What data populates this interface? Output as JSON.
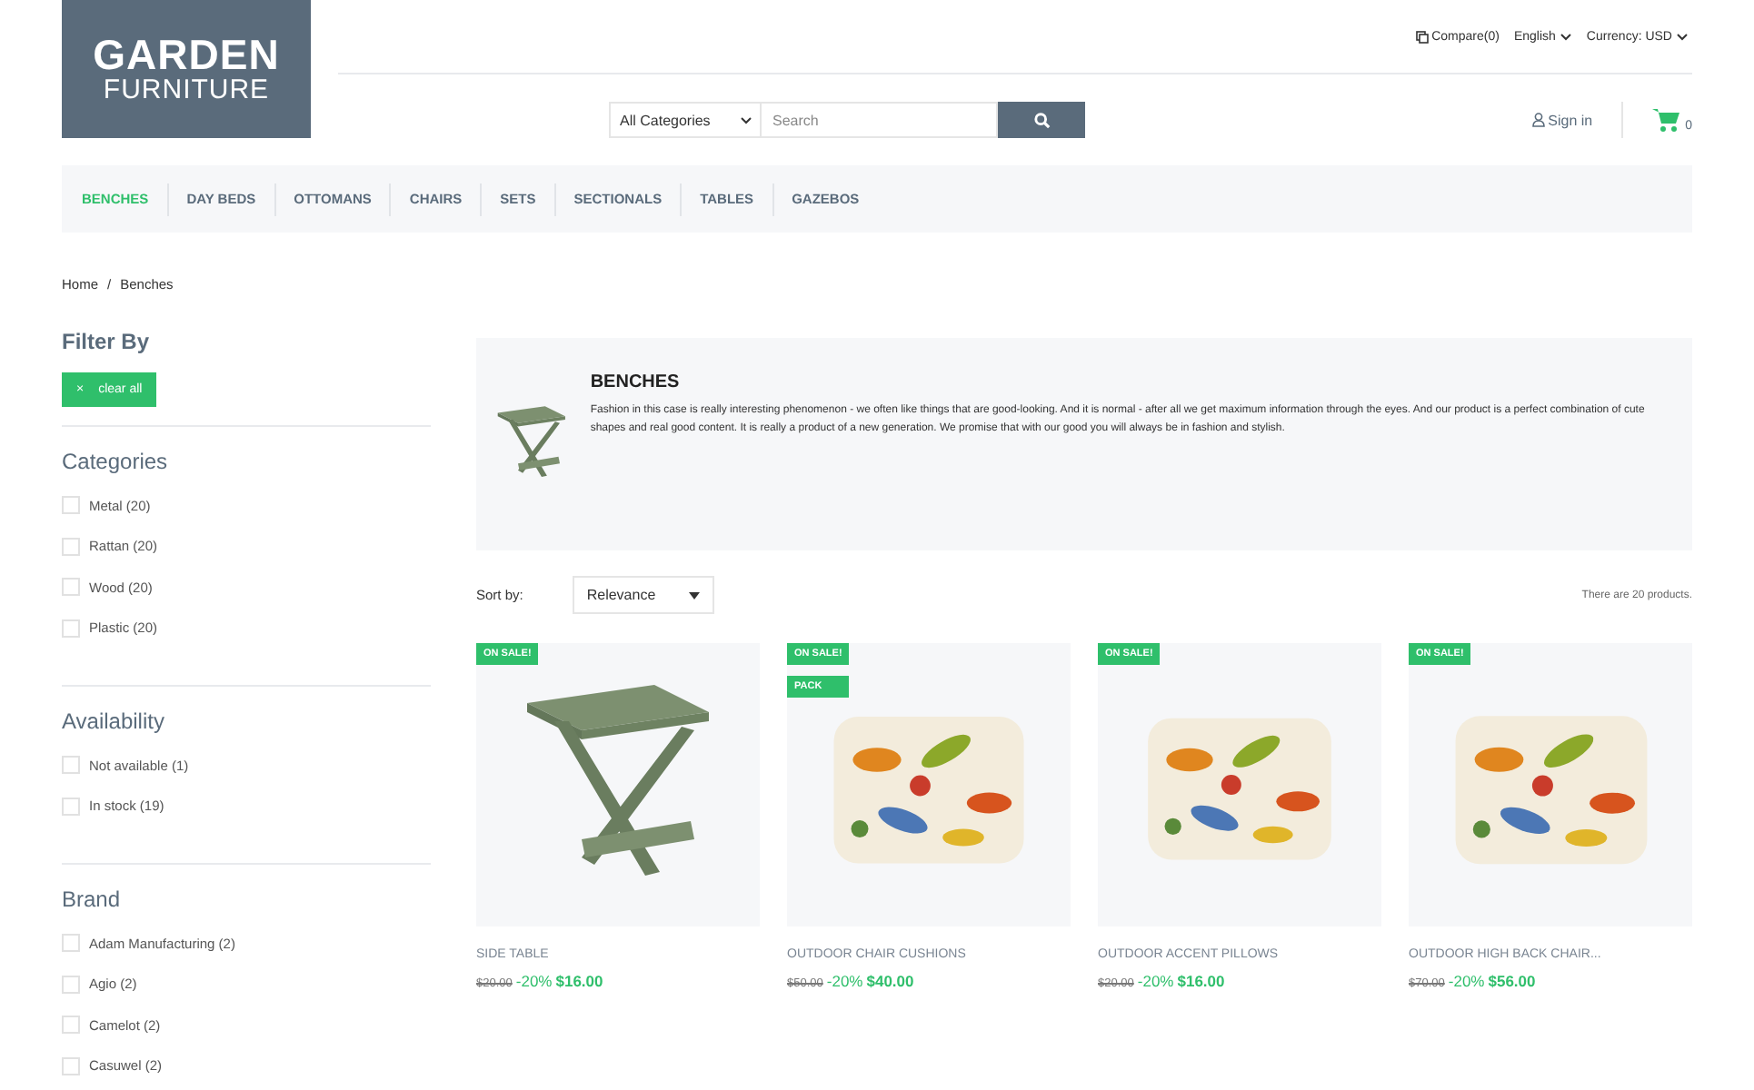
{
  "logo": {
    "line1": "GARDEN",
    "line2": "FURNITURE"
  },
  "top_links": {
    "compare": "Compare(0)",
    "language": "English",
    "currency": "Currency: USD"
  },
  "search": {
    "category": "All Categories",
    "placeholder": "Search"
  },
  "account": {
    "sign_in": "Sign in",
    "cart_count": "0"
  },
  "nav": [
    {
      "label": "BENCHES",
      "selected": true
    },
    {
      "label": "DAY BEDS",
      "selected": false
    },
    {
      "label": "OTTOMANS",
      "selected": false
    },
    {
      "label": "CHAIRS",
      "selected": false
    },
    {
      "label": "SETS",
      "selected": false
    },
    {
      "label": "SECTIONALS",
      "selected": false
    },
    {
      "label": "TABLES",
      "selected": false
    },
    {
      "label": "GAZEBOS",
      "selected": false
    }
  ],
  "breadcrumb": [
    "Home",
    "Benches"
  ],
  "breadcrumb_separator": "/",
  "filter": {
    "title": "Filter By",
    "clear_icon": "×",
    "clear": "clear all",
    "groups": [
      {
        "title": "Categories",
        "options": [
          {
            "label": "Metal (20)",
            "checked": false
          },
          {
            "label": "Rattan (20)",
            "checked": false
          },
          {
            "label": "Wood (20)",
            "checked": false
          },
          {
            "label": "Plastic (20)",
            "checked": false
          }
        ]
      },
      {
        "title": "Availability",
        "options": [
          {
            "label": "Not available (1)",
            "checked": false
          },
          {
            "label": "In stock (19)",
            "checked": false
          }
        ]
      },
      {
        "title": "Brand",
        "options": [
          {
            "label": "Adam Manufacturing (2)",
            "checked": false
          },
          {
            "label": "Agio (2)",
            "checked": false
          },
          {
            "label": "Camelot (2)",
            "checked": false
          },
          {
            "label": "Casuwel (2)",
            "checked": false
          }
        ]
      }
    ]
  },
  "category_banner": {
    "title": "BENCHES",
    "description": "Fashion in this case is really interesting phenomenon - we often like things that are good-looking. And it is normal - after all we get maximum information through the eyes. And our product is a perfect combination of cute shapes and real good content. It is really a product of a new generation. We promise that with our good you will always be in fashion and stylish."
  },
  "sort": {
    "label": "Sort by:",
    "value": "Relevance",
    "count": "There are 20 products."
  },
  "products": [
    {
      "kind": "table",
      "badges": [
        "ON SALE!"
      ],
      "name": "SIDE TABLE",
      "old_price": "$20.00",
      "discount": "-20%",
      "price": "$16.00"
    },
    {
      "kind": "cushions",
      "badges": [
        "ON SALE!",
        "PACK"
      ],
      "name": "OUTDOOR CHAIR CUSHIONS",
      "old_price": "$50.00",
      "discount": "-20%",
      "price": "$40.00"
    },
    {
      "kind": "pillows",
      "badges": [
        "ON SALE!"
      ],
      "name": "OUTDOOR ACCENT PILLOWS",
      "old_price": "$20.00",
      "discount": "-20%",
      "price": "$16.00"
    },
    {
      "kind": "chair_cushion",
      "badges": [
        "ON SALE!"
      ],
      "name": "OUTDOOR HIGH BACK CHAIR...",
      "old_price": "$70.00",
      "discount": "-20%",
      "price": "$56.00"
    }
  ]
}
